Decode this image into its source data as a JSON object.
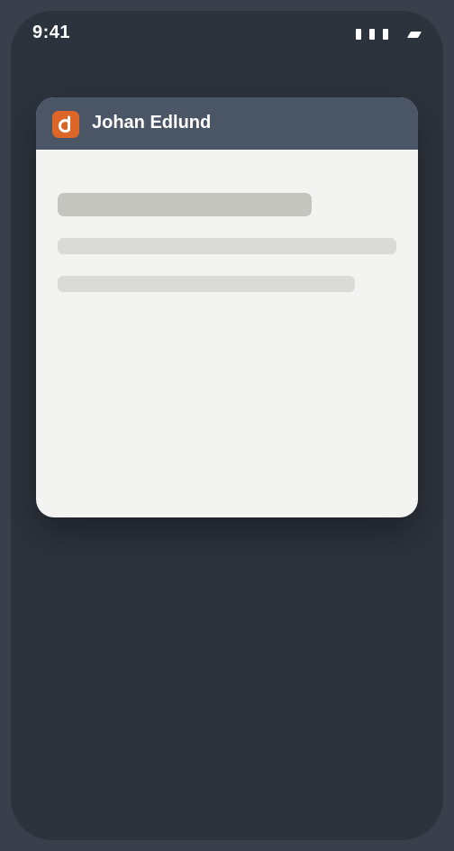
{
  "status_bar": {
    "time": "9:41"
  },
  "notification": {
    "app_icon": "app-logo-icon",
    "sender": "Johan Edlund"
  },
  "colors": {
    "device_frame": "#3a404b",
    "screen_background": "#2d333d",
    "card_header": "#4a5566",
    "card_body": "#f3f3f1",
    "app_icon_accent": "#dd6527"
  }
}
